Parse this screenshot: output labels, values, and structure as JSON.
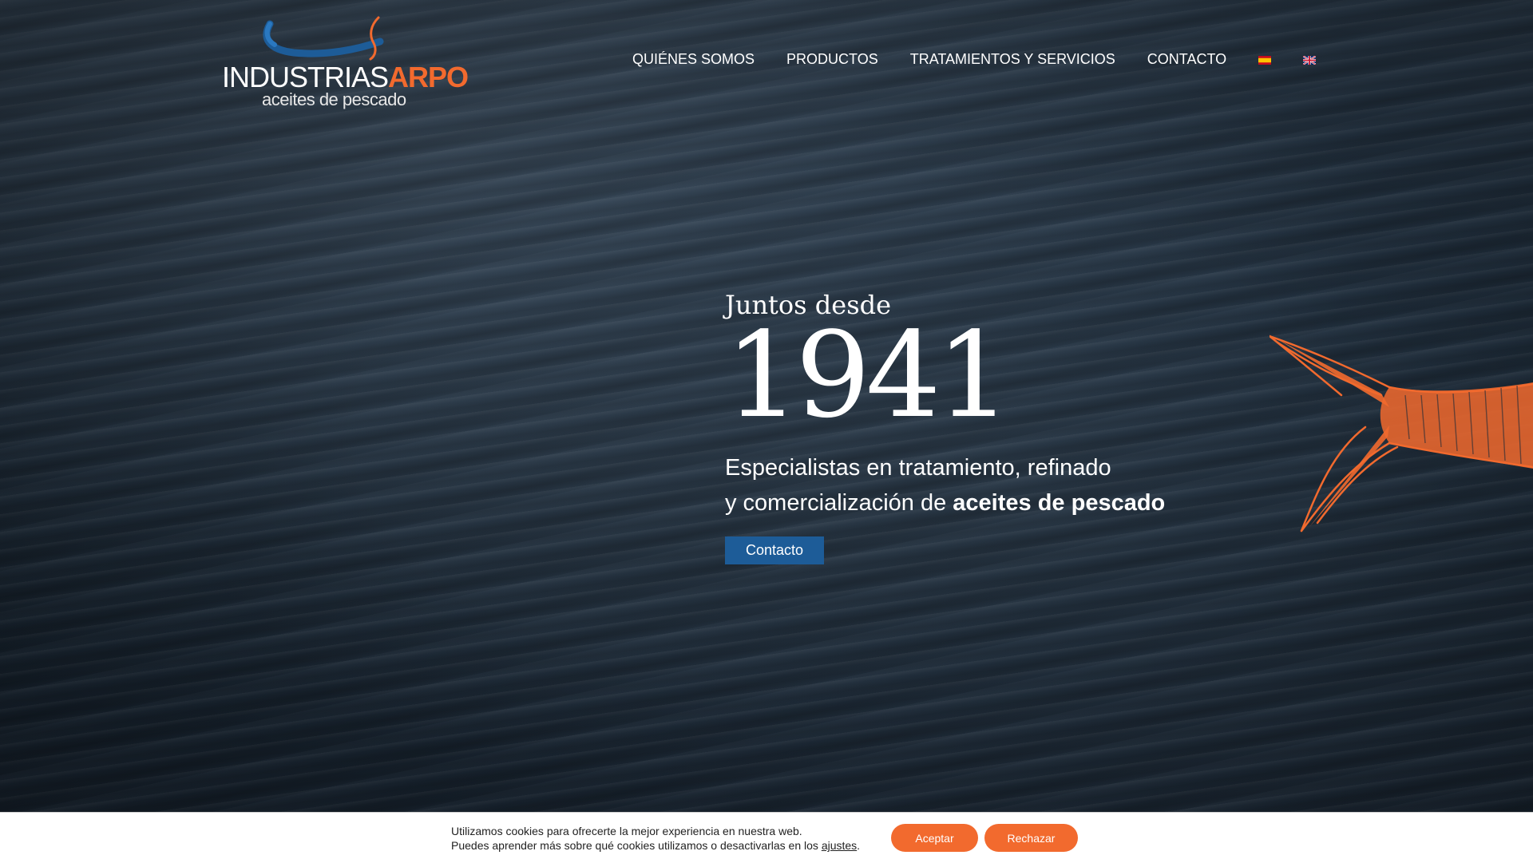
{
  "brand": {
    "logo_main": "INDUSTRIAS",
    "logo_accent": "ARPO",
    "logo_sub": "aceites de pescado",
    "colors": {
      "accent": "#f26a2e",
      "blue": "#1d5c98"
    }
  },
  "nav": {
    "items": [
      {
        "label": "QUIÉNES SOMOS"
      },
      {
        "label": "PRODUCTOS"
      },
      {
        "label": "TRATAMIENTOS Y SERVICIOS"
      },
      {
        "label": "CONTACTO"
      }
    ],
    "languages": [
      {
        "icon": "flag-spain-icon"
      },
      {
        "icon": "flag-uk-icon"
      }
    ]
  },
  "hero": {
    "tagline": "Juntos desde",
    "year": "1941",
    "desc_line1": "Especialistas en tratamiento, refinado",
    "desc_line2_prefix": "y comercialización de ",
    "desc_line2_bold": "aceites de pescado",
    "cta_label": "Contacto",
    "decoration_icon": "fish-illustration-icon"
  },
  "cookies": {
    "line1": "Utilizamos cookies para ofrecerte la mejor experiencia en nuestra web.",
    "line2_prefix": "Puedes aprender más sobre qué cookies utilizamos o desactivarlas en los ",
    "line2_link": "ajustes",
    "line2_suffix": ".",
    "accept_label": "Aceptar",
    "reject_label": "Rechazar"
  }
}
